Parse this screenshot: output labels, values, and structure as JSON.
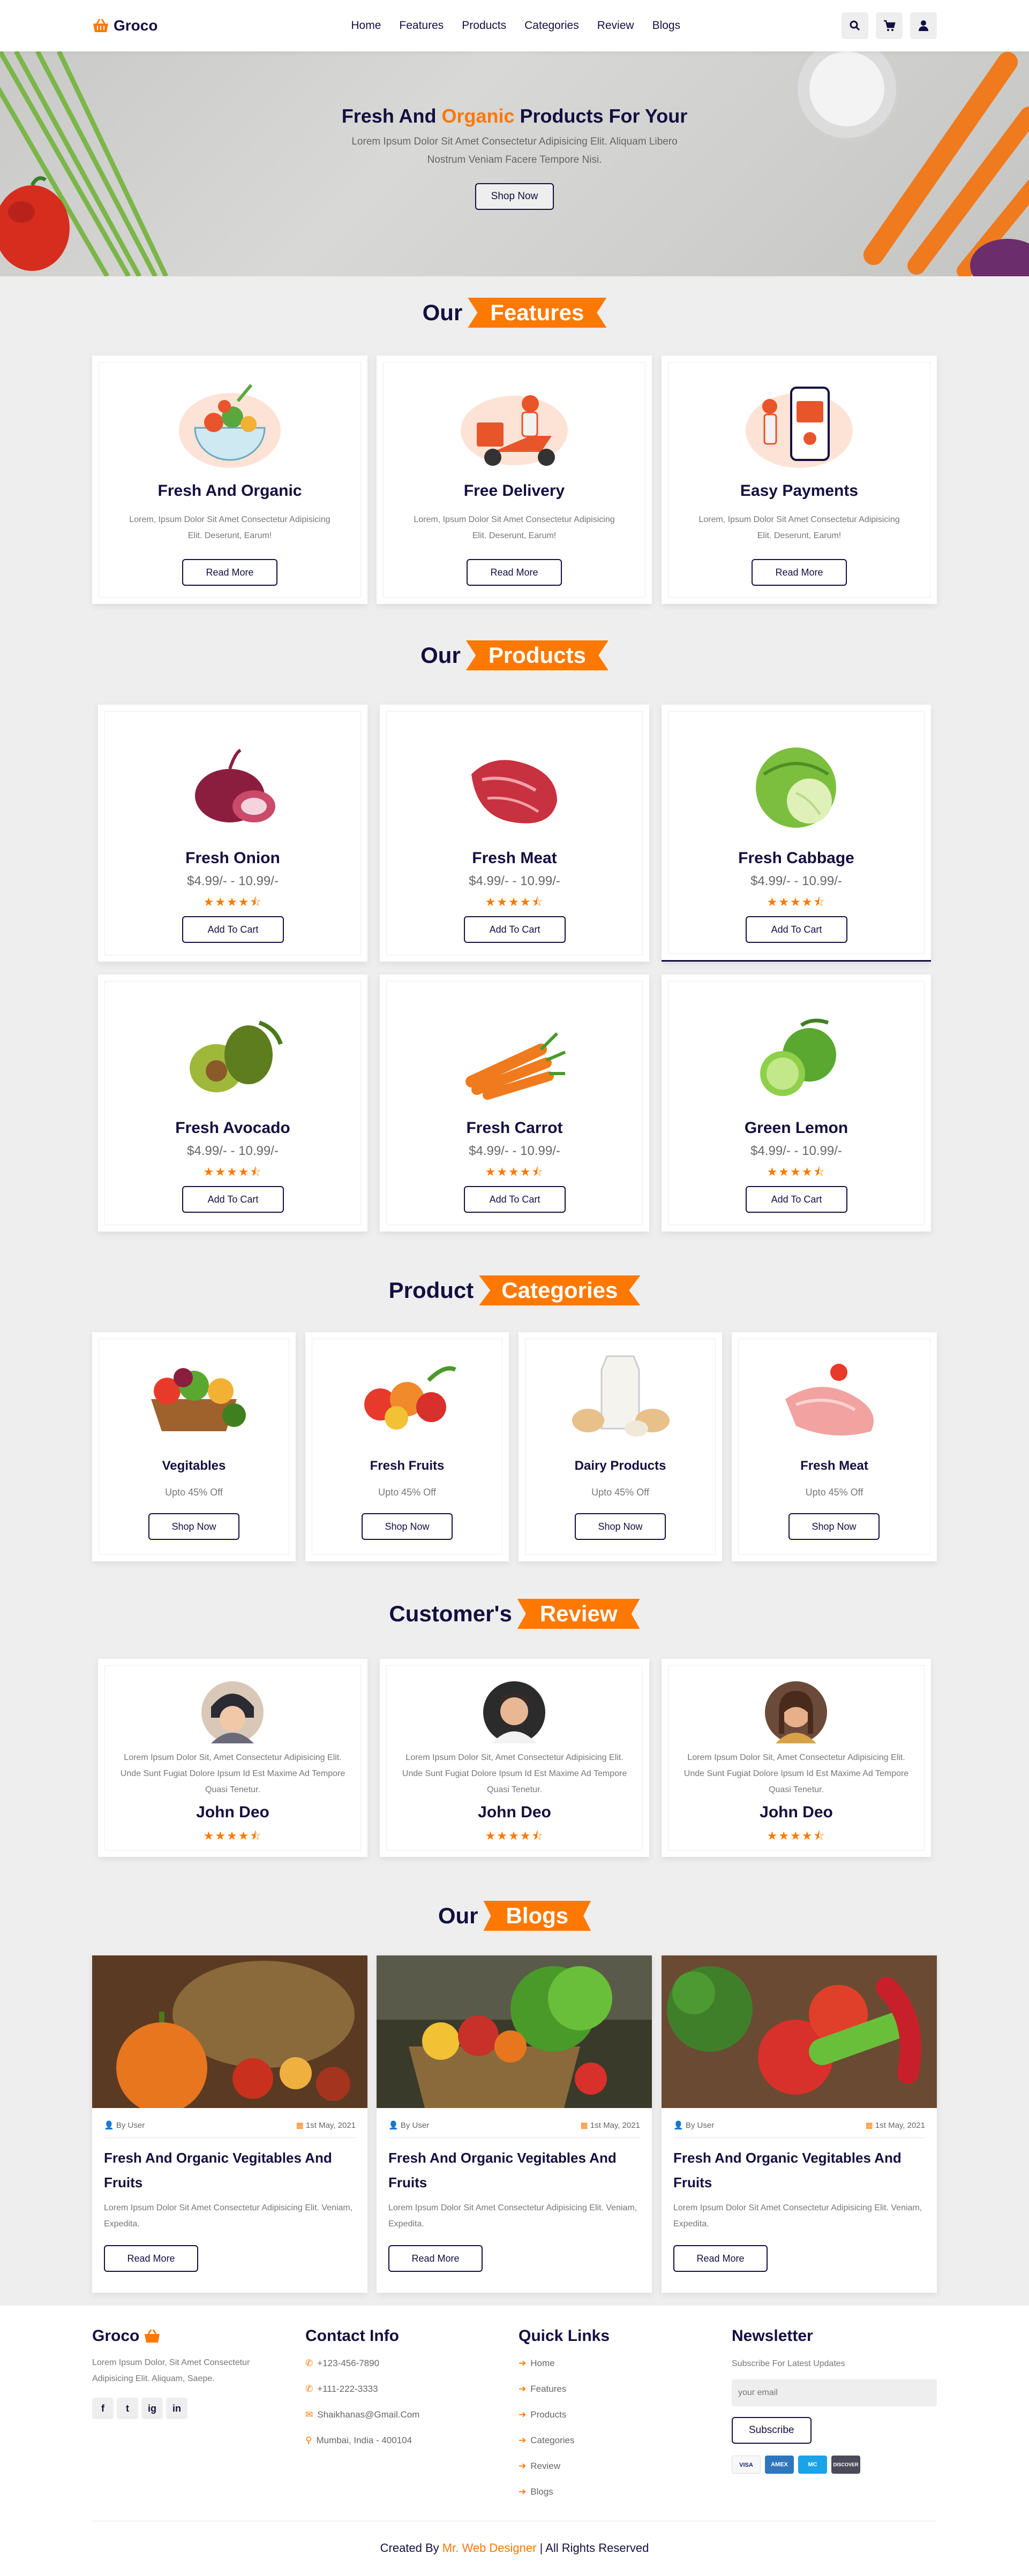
{
  "header": {
    "logo": "Groco",
    "nav": [
      "Home",
      "Features",
      "Products",
      "Categories",
      "Review",
      "Blogs"
    ],
    "icons": [
      "search-icon",
      "cart-icon",
      "user-icon"
    ]
  },
  "hero": {
    "title_a": "Fresh And ",
    "title_b": "Organic",
    "title_c": " Products For Your",
    "text": "Lorem Ipsum Dolor Sit Amet Consectetur Adipisicing Elit. Aliquam Libero Nostrum Veniam Facere Tempore Nisi.",
    "button": "Shop Now"
  },
  "features": {
    "title_a": "Our",
    "title_b": "Features",
    "items": [
      {
        "title": "Fresh And Organic",
        "text": "Lorem, Ipsum Dolor Sit Amet Consectetur Adipisicing Elit. Deserunt, Earum!",
        "button": "Read More"
      },
      {
        "title": "Free Delivery",
        "text": "Lorem, Ipsum Dolor Sit Amet Consectetur Adipisicing Elit. Deserunt, Earum!",
        "button": "Read More"
      },
      {
        "title": "Easy Payments",
        "text": "Lorem, Ipsum Dolor Sit Amet Consectetur Adipisicing Elit. Deserunt, Earum!",
        "button": "Read More"
      }
    ]
  },
  "products": {
    "title_a": "Our",
    "title_b": "Products",
    "items": [
      {
        "name": "Fresh Onion",
        "price": "$4.99/- - 10.99/-",
        "stars": "★★★★⯪",
        "button": "Add To Cart"
      },
      {
        "name": "Fresh Meat",
        "price": "$4.99/- - 10.99/-",
        "stars": "★★★★⯪",
        "button": "Add To Cart"
      },
      {
        "name": "Fresh Cabbage",
        "price": "$4.99/- - 10.99/-",
        "stars": "★★★★⯪",
        "button": "Add To Cart"
      },
      {
        "name": "Fresh Avocado",
        "price": "$4.99/- - 10.99/-",
        "stars": "★★★★⯪",
        "button": "Add To Cart"
      },
      {
        "name": "Fresh Carrot",
        "price": "$4.99/- - 10.99/-",
        "stars": "★★★★⯪",
        "button": "Add To Cart"
      },
      {
        "name": "Green Lemon",
        "price": "$4.99/- - 10.99/-",
        "stars": "★★★★⯪",
        "button": "Add To Cart"
      }
    ]
  },
  "categories": {
    "title_a": "Product",
    "title_b": "Categories",
    "items": [
      {
        "name": "Vegitables",
        "offer": "Upto 45% Off",
        "button": "Shop Now"
      },
      {
        "name": "Fresh Fruits",
        "offer": "Upto 45% Off",
        "button": "Shop Now"
      },
      {
        "name": "Dairy Products",
        "offer": "Upto 45% Off",
        "button": "Shop Now"
      },
      {
        "name": "Fresh Meat",
        "offer": "Upto 45% Off",
        "button": "Shop Now"
      }
    ]
  },
  "review": {
    "title_a": "Customer's",
    "title_b": "Review",
    "items": [
      {
        "text": "Lorem Ipsum Dolor Sit, Amet Consectetur Adipisicing Elit. Unde Sunt Fugiat Dolore Ipsum Id Est Maxime Ad Tempore Quasi Tenetur.",
        "name": "John Deo",
        "stars": "★★★★⯪"
      },
      {
        "text": "Lorem Ipsum Dolor Sit, Amet Consectetur Adipisicing Elit. Unde Sunt Fugiat Dolore Ipsum Id Est Maxime Ad Tempore Quasi Tenetur.",
        "name": "John Deo",
        "stars": "★★★★⯪"
      },
      {
        "text": "Lorem Ipsum Dolor Sit, Amet Consectetur Adipisicing Elit. Unde Sunt Fugiat Dolore Ipsum Id Est Maxime Ad Tempore Quasi Tenetur.",
        "name": "John Deo",
        "stars": "★★★★⯪"
      }
    ]
  },
  "blogs": {
    "title_a": "Our",
    "title_b": "Blogs",
    "items": [
      {
        "author": "By User",
        "date": "1st May, 2021",
        "title": "Fresh And Organic Vegitables And Fruits",
        "text": "Lorem Ipsum Dolor Sit Amet Consectetur Adipisicing Elit. Veniam, Expedita.",
        "button": "Read More"
      },
      {
        "author": "By User",
        "date": "1st May, 2021",
        "title": "Fresh And Organic Vegitables And Fruits",
        "text": "Lorem Ipsum Dolor Sit Amet Consectetur Adipisicing Elit. Veniam, Expedita.",
        "button": "Read More"
      },
      {
        "author": "By User",
        "date": "1st May, 2021",
        "title": "Fresh And Organic Vegitables And Fruits",
        "text": "Lorem Ipsum Dolor Sit Amet Consectetur Adipisicing Elit. Veniam, Expedita.",
        "button": "Read More"
      }
    ]
  },
  "footer": {
    "logo": "Groco",
    "about": "Lorem Ipsum Dolor, Sit Amet Consectetur Adipisicing Elit. Aliquam, Saepe.",
    "social": [
      "f",
      "t",
      "ig",
      "in"
    ],
    "contact_title": "Contact Info",
    "contact": [
      "+123-456-7890",
      "+111-222-3333",
      "Shaikhanas@Gmail.Com",
      "Mumbai, India - 400104"
    ],
    "links_title": "Quick Links",
    "links": [
      "Home",
      "Features",
      "Products",
      "Categories",
      "Review",
      "Blogs"
    ],
    "news_title": "Newsletter",
    "news_text": "Subscribe For Latest Updates",
    "news_placeholder": "your email",
    "news_button": "Subscribe",
    "payments": [
      "VISA",
      "AMEX",
      "MC",
      "DISCOVER"
    ],
    "credit_a": "Created By ",
    "credit_b": "Mr. Web Designer",
    "credit_c": " | All Rights Reserved"
  }
}
